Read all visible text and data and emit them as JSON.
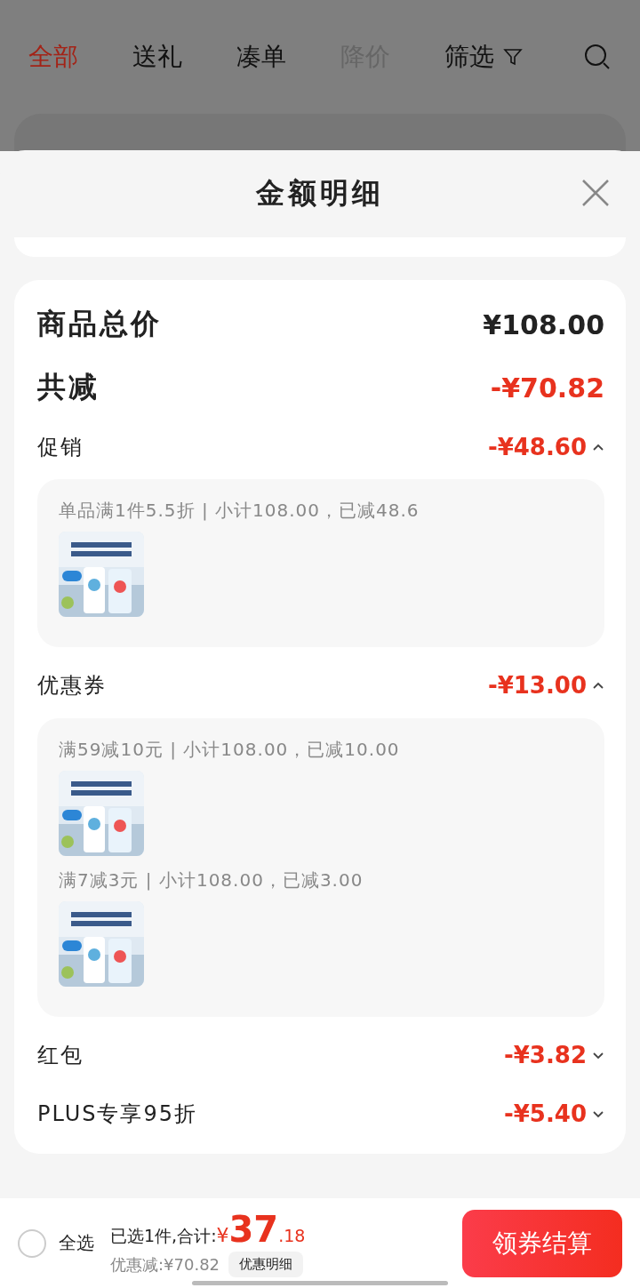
{
  "nav": {
    "tabs": [
      {
        "label": "全部",
        "selected": true,
        "muted": false,
        "kind": "text"
      },
      {
        "label": "送礼",
        "selected": false,
        "muted": false,
        "kind": "text"
      },
      {
        "label": "凑单",
        "selected": false,
        "muted": false,
        "kind": "text"
      },
      {
        "label": "降价",
        "selected": false,
        "muted": true,
        "kind": "text"
      },
      {
        "label": "筛选",
        "selected": false,
        "muted": false,
        "kind": "filter"
      }
    ]
  },
  "sheet": {
    "title": "金额明细",
    "total": {
      "label": "商品总价",
      "value": "¥108.00"
    },
    "reduction": {
      "label": "共减",
      "value": "-¥70.82"
    },
    "sections": [
      {
        "label": "促销",
        "value": "-¥48.60",
        "expanded": true,
        "details": [
          {
            "text": "单品满1件5.5折 | 小计108.00，已减48.6",
            "kind": "picture"
          }
        ]
      },
      {
        "label": "优惠券",
        "value": "-¥13.00",
        "expanded": true,
        "details": [
          {
            "text": "满59减10元 | 小计108.00，已减10.00",
            "kind": "picture"
          },
          {
            "text": "满7减3元 | 小计108.00，已减3.00",
            "kind": "picture"
          }
        ]
      },
      {
        "label": "红包",
        "value": "-¥3.82",
        "expanded": false
      },
      {
        "label": "PLUS专享95折",
        "value": "-¥5.40",
        "expanded": false
      }
    ]
  },
  "footer": {
    "select_all": {
      "label": "全选",
      "checked": false
    },
    "summary": "已选1件,合计:",
    "currency": "¥",
    "price_int": "37",
    "price_dec": ".18",
    "discount": "优惠减:¥70.82",
    "detail_button": "优惠明细",
    "checkout": "领券结算"
  }
}
